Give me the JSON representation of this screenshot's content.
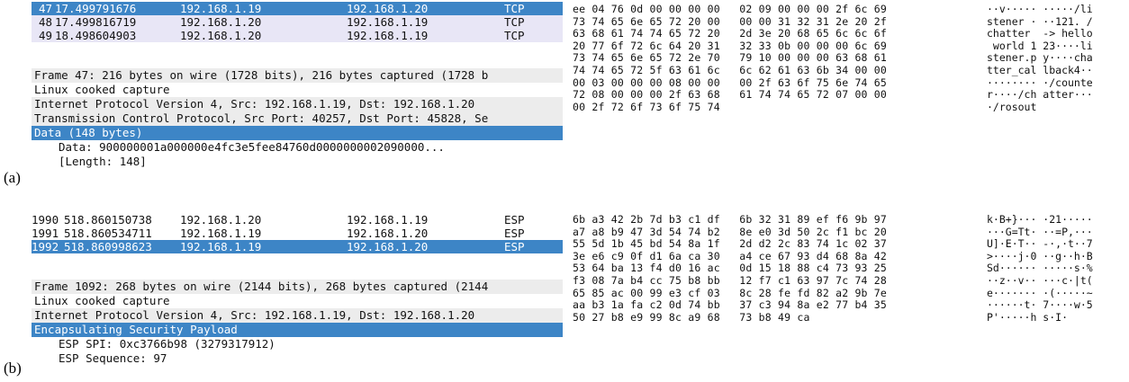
{
  "panels": [
    {
      "label": "(a)",
      "packets": [
        {
          "no": "47",
          "time": "17.499791676",
          "src": "192.168.1.19",
          "dst": "192.168.1.20",
          "proto": "TCP",
          "state": "sel"
        },
        {
          "no": "48",
          "time": "17.499816719",
          "src": "192.168.1.20",
          "dst": "192.168.1.19",
          "proto": "TCP",
          "state": "alt"
        },
        {
          "no": "49",
          "time": "18.498604903",
          "src": "192.168.1.20",
          "dst": "192.168.1.19",
          "proto": "TCP",
          "state": "alt"
        }
      ],
      "details": [
        {
          "text": "Frame 47: 216 bytes on wire (1728 bits), 216 bytes captured (1728 b",
          "style": "gray"
        },
        {
          "text": "Linux cooked capture",
          "style": "plain"
        },
        {
          "text": "Internet Protocol Version 4, Src: 192.168.1.19, Dst: 192.168.1.20",
          "style": "gray"
        },
        {
          "text": "Transmission Control Protocol, Src Port: 40257, Dst Port: 45828, Se",
          "style": "gray"
        },
        {
          "text": "Data (148 bytes)",
          "style": "sel"
        },
        {
          "text": "Data: 900000001a000000e4fc3e5fee84760d0000000002090000...",
          "style": "child"
        },
        {
          "text": "[Length: 148]",
          "style": "child"
        }
      ],
      "hex_lines": [
        "ee 04 76 0d 00 00 00 00   02 09 00 00 00 2f 6c 69",
        "73 74 65 6e 65 72 20 00   00 00 31 32 31 2e 20 2f",
        "63 68 61 74 74 65 72 20   2d 3e 20 68 65 6c 6c 6f",
        "20 77 6f 72 6c 64 20 31   32 33 0b 00 00 00 6c 69",
        "73 74 65 6e 65 72 2e 70   79 10 00 00 00 63 68 61",
        "74 74 65 72 5f 63 61 6c   6c 62 61 63 6b 34 00 00",
        "00 03 00 00 00 08 00 00   00 2f 63 6f 75 6e 74 65",
        "72 08 00 00 00 2f 63 68   61 74 74 65 72 07 00 00",
        "00 2f 72 6f 73 6f 75 74"
      ],
      "ascii_lines": [
        "··v····· ·····/li",
        "stener · ··121. /",
        "chatter  -> hello",
        " world 1 23····li",
        "stener.p y····cha",
        "tter_cal lback4··",
        "········ ·/counte",
        "r····/ch atter···",
        "·/rosout"
      ]
    },
    {
      "label": "(b)",
      "packets": [
        {
          "no": "1990",
          "time": "518.860150738",
          "src": "192.168.1.20",
          "dst": "192.168.1.19",
          "proto": "ESP",
          "state": "plain"
        },
        {
          "no": "1991",
          "time": "518.860534711",
          "src": "192.168.1.19",
          "dst": "192.168.1.20",
          "proto": "ESP",
          "state": "plain"
        },
        {
          "no": "1992",
          "time": "518.860998623",
          "src": "192.168.1.19",
          "dst": "192.168.1.20",
          "proto": "ESP",
          "state": "sel"
        }
      ],
      "details": [
        {
          "text": "Frame 1092: 268 bytes on wire (2144 bits), 268 bytes captured (2144",
          "style": "gray"
        },
        {
          "text": "Linux cooked capture",
          "style": "plain"
        },
        {
          "text": "Internet Protocol Version 4, Src: 192.168.1.19, Dst: 192.168.1.20",
          "style": "gray"
        },
        {
          "text": "Encapsulating Security Payload",
          "style": "sel"
        },
        {
          "text": "ESP SPI: 0xc3766b98 (3279317912)",
          "style": "child"
        },
        {
          "text": "ESP Sequence: 97",
          "style": "child"
        }
      ],
      "hex_lines": [
        "6b a3 42 2b 7d b3 c1 df   6b 32 31 89 ef f6 9b 97",
        "a7 a8 b9 47 3d 54 74 b2   8e e0 3d 50 2c f1 bc 20",
        "55 5d 1b 45 bd 54 8a 1f   2d d2 2c 83 74 1c 02 37",
        "3e e6 c9 0f d1 6a ca 30   a4 ce 67 93 d4 68 8a 42",
        "53 64 ba 13 f4 d0 16 ac   0d 15 18 88 c4 73 93 25",
        "f3 08 7a b4 cc 75 b8 bb   12 f7 c1 63 97 7c 74 28",
        "65 85 ac 00 99 e3 cf 03   8c 28 fe fd 82 a2 9b 7e",
        "aa b3 1a fa c2 0d 74 bb   37 c3 94 8a e2 77 b4 35",
        "50 27 b8 e9 99 8c a9 68   73 b8 49 ca"
      ],
      "ascii_lines": [
        "k·B+}··· ·21·····",
        "···G=Tt· ··=P,···",
        "U]·E·T·· -·,·t··7",
        ">····j·0 ··g··h·B",
        "Sd······ ·····s·%",
        "··z··v·· ···c·|t(",
        "e······· ·(·····~",
        "······t· 7····w·5",
        "P'·····h s·I·"
      ]
    }
  ]
}
